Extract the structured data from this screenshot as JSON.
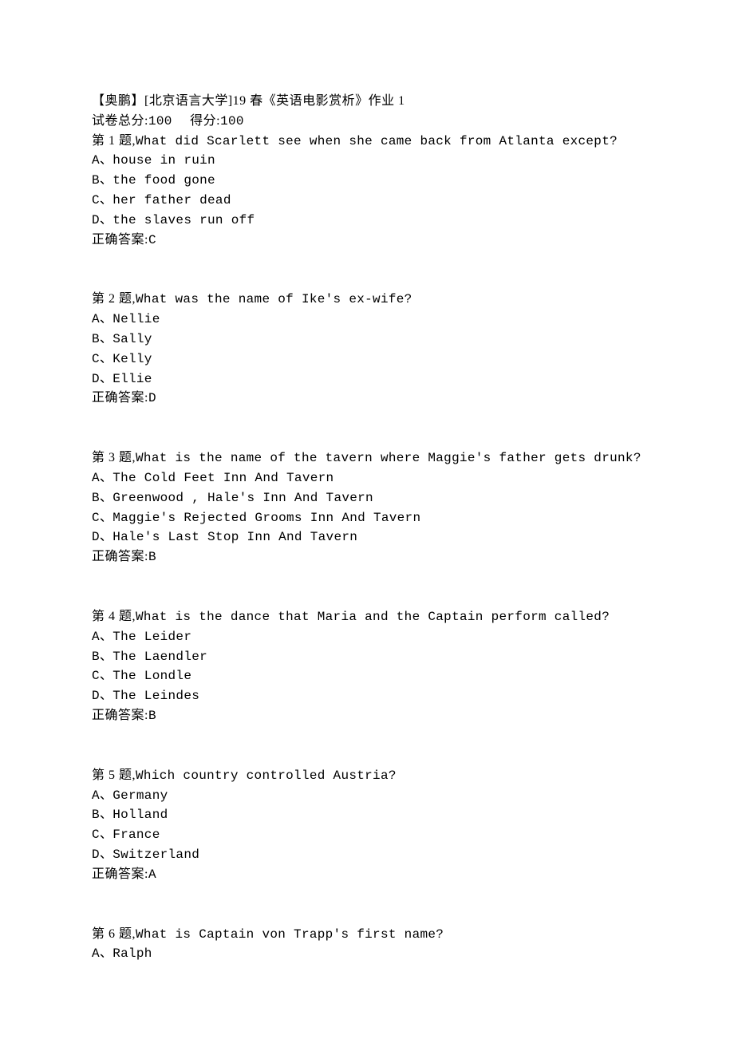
{
  "header": {
    "title_prefix": "【奥鹏】[北京语言大学]19 春《英语电影赏析》作业 1",
    "score_line_prefix": "试卷总分:",
    "total_score": "100",
    "score_gap": "     ",
    "score_line_mid": "得分:",
    "obtained_score": "100"
  },
  "questions": [
    {
      "num": "第 1 题,",
      "text": "What did Scarlett see when she came back from Atlanta except?",
      "options": [
        "A、house in ruin",
        "B、the food gone",
        "C、her father dead",
        "D、the slaves run off"
      ],
      "answer_label": "正确答案:",
      "answer": "C"
    },
    {
      "num": "第 2 题,",
      "text": "What was the name of Ike's ex-wife?",
      "options": [
        "A、Nellie",
        "B、Sally",
        "C、Kelly",
        "D、Ellie"
      ],
      "answer_label": "正确答案:",
      "answer": "D"
    },
    {
      "num": "第 3 题,",
      "text": "What is the name of the tavern where Maggie's father gets drunk?",
      "options": [
        "A、The Cold Feet Inn And Tavern",
        "B、Greenwood , Hale's Inn And Tavern",
        "C、Maggie's Rejected Grooms Inn And Tavern",
        "D、Hale's Last Stop Inn And Tavern"
      ],
      "answer_label": "正确答案:",
      "answer": "B"
    },
    {
      "num": "第 4 题,",
      "text": "What is the dance that Maria and the Captain perform called?",
      "options": [
        "A、The Leider",
        "B、The Laendler",
        "C、The Londle",
        "D、The Leindes"
      ],
      "answer_label": "正确答案:",
      "answer": "B"
    },
    {
      "num": "第 5 题,",
      "text": "Which country controlled Austria?",
      "options": [
        "A、Germany",
        "B、Holland",
        "C、France",
        "D、Switzerland"
      ],
      "answer_label": "正确答案:",
      "answer": "A"
    },
    {
      "num": "第 6 题,",
      "text": "What is Captain von Trapp's first name?",
      "options_partial": [
        "A、Ralph"
      ]
    }
  ]
}
